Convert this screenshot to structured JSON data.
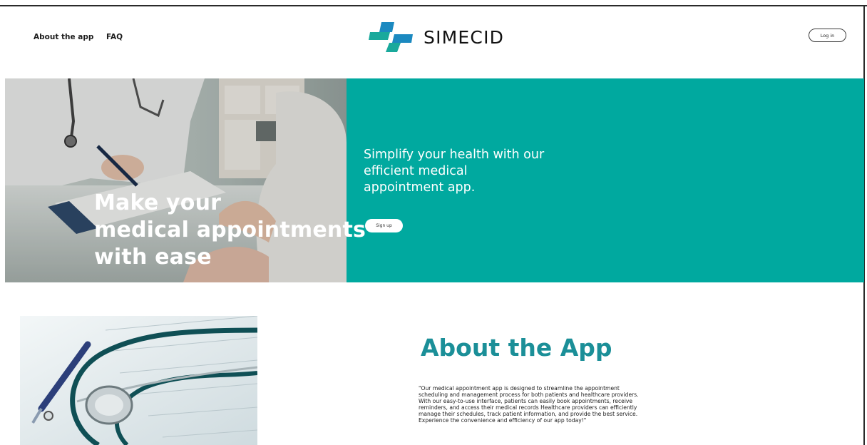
{
  "header": {
    "nav": [
      {
        "label": "About the app"
      },
      {
        "label": "FAQ"
      }
    ],
    "logo_text": "SIMECID",
    "login_label": "Log in"
  },
  "hero": {
    "headline_lines": [
      "Make your",
      "medical appointments",
      "with ease"
    ],
    "tagline_lines": [
      "Simplify your health with our",
      "efficient medical",
      "appointment app."
    ],
    "signup_label": "Sign up"
  },
  "about": {
    "title": "About the App",
    "body_lines": [
      "\"Our medical appointment app is designed to streamline the appointment",
      "scheduling and management process for both patients and healthcare providers.",
      "With our easy-to-use interface, patients can easily book appointments, receive",
      "reminders, and access their medical records Healthcare providers can efficiently",
      "manage their schedules, track patient information, and provide the best service.",
      "Experience the convenience and efficiency of our app today!\""
    ]
  },
  "colors": {
    "brand_teal": "#00a99f",
    "title_teal": "#1b8f98",
    "logo_teal": "#19a99c",
    "logo_blue": "#1b89c0"
  },
  "icons": {
    "logo": "medical-cross-logo-icon"
  }
}
